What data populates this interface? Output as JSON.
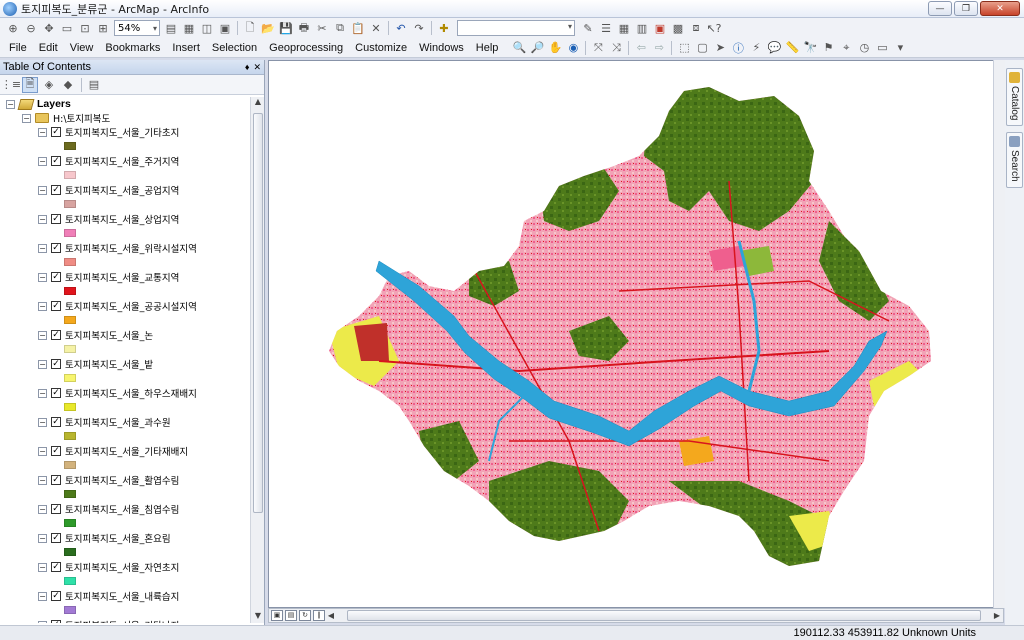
{
  "window": {
    "title": "토지피복도_분류군 - ArcMap - ArcInfo",
    "minimize": "—",
    "maximize": "❐",
    "close": "✕"
  },
  "toolbar_top": {
    "zoom_value": "54%"
  },
  "menu": [
    "File",
    "Edit",
    "View",
    "Bookmarks",
    "Insert",
    "Selection",
    "Geoprocessing",
    "Customize",
    "Windows",
    "Help"
  ],
  "toc": {
    "title": "Table Of Contents",
    "pin": "♦",
    "close": "✕",
    "root_label": "Layers",
    "folder_label": "H:\\토지피복도",
    "layers": [
      {
        "name": "토지피복지도_서울_기타초지",
        "color": "#6b6a1e"
      },
      {
        "name": "토지피복지도_서울_주거지역",
        "color": "#f7c7cc"
      },
      {
        "name": "토지피복지도_서울_공업지역",
        "color": "#d7a3a0"
      },
      {
        "name": "토지피복지도_서울_상업지역",
        "color": "#f07fb8"
      },
      {
        "name": "토지피복지도_서울_위락시설지역",
        "color": "#ef8c84"
      },
      {
        "name": "토지피복지도_서울_교통지역",
        "color": "#e0141c"
      },
      {
        "name": "토지피복지도_서울_공공시설지역",
        "color": "#f4a81d"
      },
      {
        "name": "토지피복지도_서울_논",
        "color": "#f5f2a6"
      },
      {
        "name": "토지피복지도_서울_밭",
        "color": "#f7f56e"
      },
      {
        "name": "토지피복지도_서울_하우스재배지",
        "color": "#e8e82a"
      },
      {
        "name": "토지피복지도_서울_과수원",
        "color": "#b8b52e"
      },
      {
        "name": "토지피복지도_서울_기타재배지",
        "color": "#d2b27c"
      },
      {
        "name": "토지피복지도_서울_활엽수림",
        "color": "#4d7a19"
      },
      {
        "name": "토지피복지도_서울_침엽수림",
        "color": "#2e9a2a"
      },
      {
        "name": "토지피복지도_서울_혼요림",
        "color": "#2a6d1e"
      },
      {
        "name": "토지피복지도_서울_자연초지",
        "color": "#2fe0a8"
      },
      {
        "name": "토지피복지도_서울_내륙습지",
        "color": "#a27ad4"
      },
      {
        "name": "토지피복지도_서울_기타나지",
        "color": "#888888"
      }
    ]
  },
  "side_tabs": [
    "Catalog",
    "Search"
  ],
  "map_colors": {
    "forest": "#4e7a1a",
    "forest_dark": "#3b6614",
    "urban": "#f2a3b6",
    "urban_dense": "#ef5f8e",
    "river": "#2ea4d8",
    "road": "#d8141e",
    "farm": "#ecea4a",
    "grass": "#8db83a"
  },
  "status": {
    "coords": "190112.33  453911.82 Unknown Units"
  }
}
